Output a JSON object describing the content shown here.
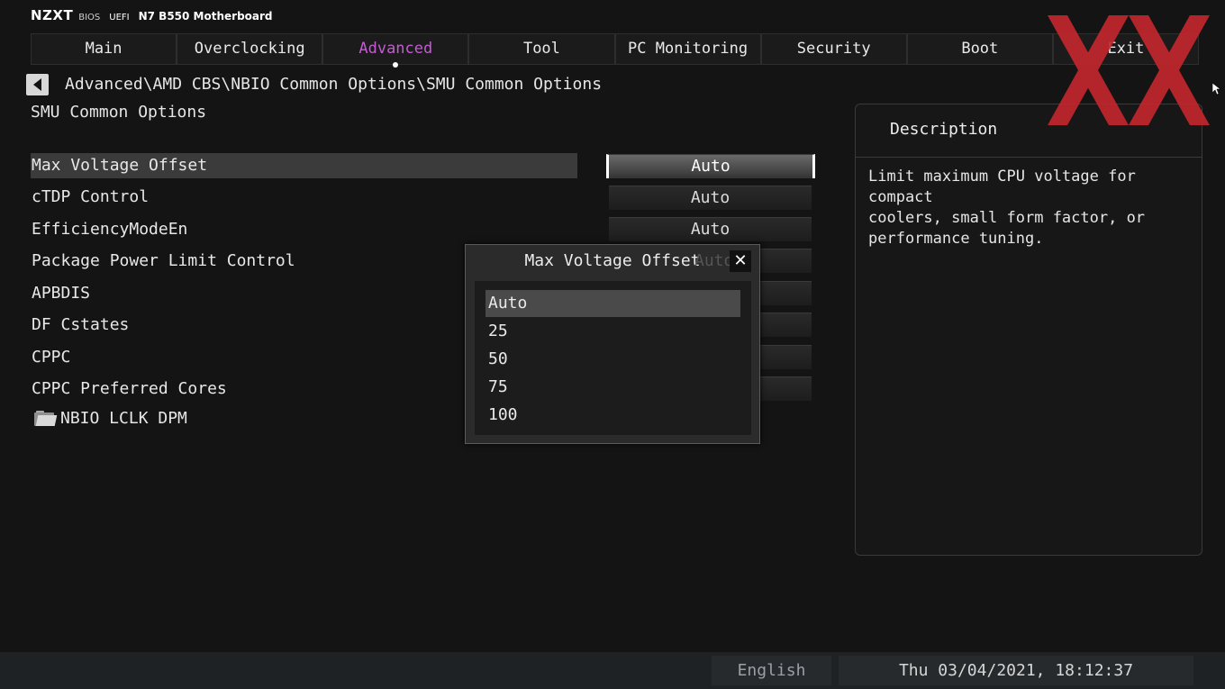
{
  "header": {
    "brand": "NZXT",
    "bios_label": "BIOS",
    "uefi_label": "UEFI",
    "model": "N7 B550 Motherboard"
  },
  "tabs": [
    {
      "label": "Main"
    },
    {
      "label": "Overclocking"
    },
    {
      "label": "Advanced"
    },
    {
      "label": "Tool"
    },
    {
      "label": "PC Monitoring"
    },
    {
      "label": "Security"
    },
    {
      "label": "Boot"
    },
    {
      "label": "Exit"
    }
  ],
  "active_tab": "Advanced",
  "breadcrumb": "Advanced\\AMD CBS\\NBIO Common Options\\SMU Common Options",
  "section_title": "SMU Common Options",
  "settings": [
    {
      "label": "Max Voltage Offset",
      "value": "Auto"
    },
    {
      "label": "cTDP Control",
      "value": "Auto"
    },
    {
      "label": "EfficiencyModeEn",
      "value": "Auto"
    },
    {
      "label": "Package Power Limit Control",
      "value": ""
    },
    {
      "label": "APBDIS",
      "value": ""
    },
    {
      "label": "DF Cstates",
      "value": ""
    },
    {
      "label": "CPPC",
      "value": ""
    },
    {
      "label": "CPPC Preferred Cores",
      "value": ""
    }
  ],
  "submenu": {
    "label": "NBIO LCLK DPM"
  },
  "popup": {
    "title": "Max Voltage Offset",
    "ghost_value": "Auto",
    "close_glyph": "✕",
    "options": [
      "Auto",
      "25",
      "50",
      "75",
      "100"
    ],
    "selected": "Auto"
  },
  "description": {
    "title": "Description",
    "text": "Limit maximum CPU voltage for compact\ncoolers, small form factor, or\nperformance tuning."
  },
  "footer": {
    "language": "English",
    "datetime": "Thu 03/04/2021, 18:12:37"
  },
  "colors": {
    "active_tab": "#c45bd1",
    "watermark": "#c1272d",
    "background": "#141414"
  },
  "icons": {
    "back": "back-arrow-icon",
    "folder": "folder-icon",
    "close": "close-icon"
  }
}
